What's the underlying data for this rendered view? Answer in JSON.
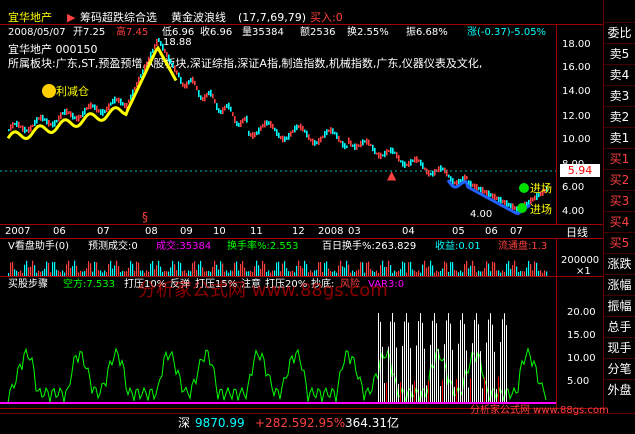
{
  "header": {
    "stock_name": "宜华地产",
    "indicator_name": "筹码超跌综合选",
    "wave_label": "黄金波浪线",
    "wave_params": "(17,7,69,79)",
    "signal": "买入:0"
  },
  "quote_line": {
    "date": "2008/05/07",
    "open": "开7.25",
    "high": "高7.45",
    "low": "低6.96",
    "close": "收6.96",
    "volume": "量35384",
    "amount": "额2536",
    "turnover": "换2.55%",
    "amplitude": "振6.68%",
    "change": "涨(-0.37)-5.05%"
  },
  "info": {
    "title": "宜华地产  000150",
    "sector": "所属板块:广东,ST,预盈预增,A股板块,深证综指,深证A指,制造指数,机械指数,广东,仪器仪表及文化,",
    "marker_text": "利减仓",
    "high_marker": "18.88",
    "low_marker": "4.00",
    "entry_label_1": "进场",
    "entry_label_2": "进场",
    "current_price": "5.94"
  },
  "price_axis": [
    "18.00",
    "16.00",
    "14.00",
    "12.00",
    "10.00",
    "8.00",
    "6.00",
    "4.00"
  ],
  "time_axis": [
    "2007",
    "06",
    "07",
    "08",
    "09",
    "10",
    "11",
    "12",
    "2008",
    "03",
    "04",
    "05",
    "06",
    "07"
  ],
  "time_axis_right": "日线",
  "volume_panel": {
    "title": "V看盘助手(0)",
    "forecast": "预测成交:0",
    "turnover_vol": "成交:35384",
    "turnover_rate": "换手率%:2.553",
    "hundred_turnover": "百日换手%:263.829",
    "income": "收益:0.01",
    "liquid": "流通盘:1.3",
    "axis_top": "200000",
    "axis_unit": "×1"
  },
  "ind_panel": {
    "title": "买股步骤",
    "short": "空方:7.533",
    "press10": "打压10%",
    "rebound": "反弹",
    "press15": "打压15%",
    "attention": "注意",
    "press20": "打压20%",
    "bottom": "抄底:",
    "risk": "风险",
    "var3": "VAR3:0",
    "axis": [
      "20.00",
      "15.00",
      "10.00",
      "5.00"
    ]
  },
  "status_bar": {
    "index_name": "深",
    "index_value": "9870.99",
    "change": "+282.59",
    "pct": "2.95%",
    "amount": "364.31亿",
    "watermark": "分析家公式网 www.88gs.com"
  },
  "watermark_text": "分析家公式网 www.88gs.com",
  "sidebar": [
    "委比",
    "卖5",
    "卖4",
    "卖3",
    "卖2",
    "卖1",
    "买1",
    "买2",
    "买3",
    "买4",
    "买5",
    "涨跌",
    "涨幅",
    "振幅",
    "总手",
    "现手",
    "分笔",
    "外盘"
  ],
  "colors": {
    "axis_red": "#a00000",
    "price_up": "#ff4040",
    "price_down": "#00ffff",
    "wave_yellow": "#ffff00",
    "wave_blue": "#2060ff"
  }
}
